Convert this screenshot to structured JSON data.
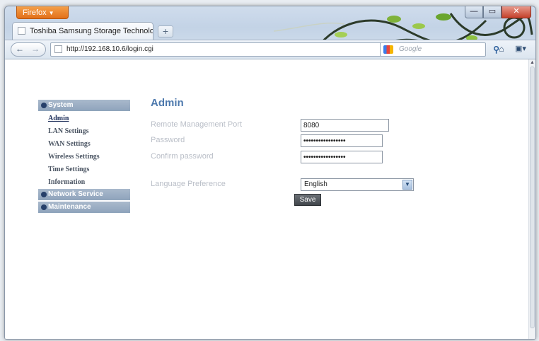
{
  "browser": {
    "menu_button": "Firefox",
    "tab_title": "Toshiba Samsung Storage Technology",
    "new_tab": "+",
    "back": "←",
    "forward": "→",
    "url": "http://192.168.10.6/login.cgi",
    "reload": "▾ C",
    "search_placeholder": "Google",
    "search_go": "⚲",
    "home": "⌂",
    "addon": "▣▾",
    "window_min": "—",
    "window_max": "▭",
    "window_close": "✕"
  },
  "sidebar": {
    "sections": [
      {
        "label": "System",
        "items": [
          "Admin",
          "LAN Settings",
          "WAN Settings",
          "Wireless Settings",
          "Time Settings",
          "Information"
        ]
      },
      {
        "label": "Network Service",
        "items": []
      },
      {
        "label": "Maintenance",
        "items": []
      }
    ],
    "active_item": "Admin"
  },
  "form": {
    "title": "Admin",
    "remote_port_label": "Remote Management Port",
    "remote_port_value": "8080",
    "password_label": "Password",
    "password_value": "•••••••••••••••••",
    "confirm_label": "Confirm password",
    "confirm_value": "•••••••••••••••••",
    "language_label": "Language Preference",
    "language_value": "English",
    "save_label": "Save"
  },
  "colors": {
    "accent": "#4d79ad",
    "sidebar_header": "#9bb0c6"
  }
}
